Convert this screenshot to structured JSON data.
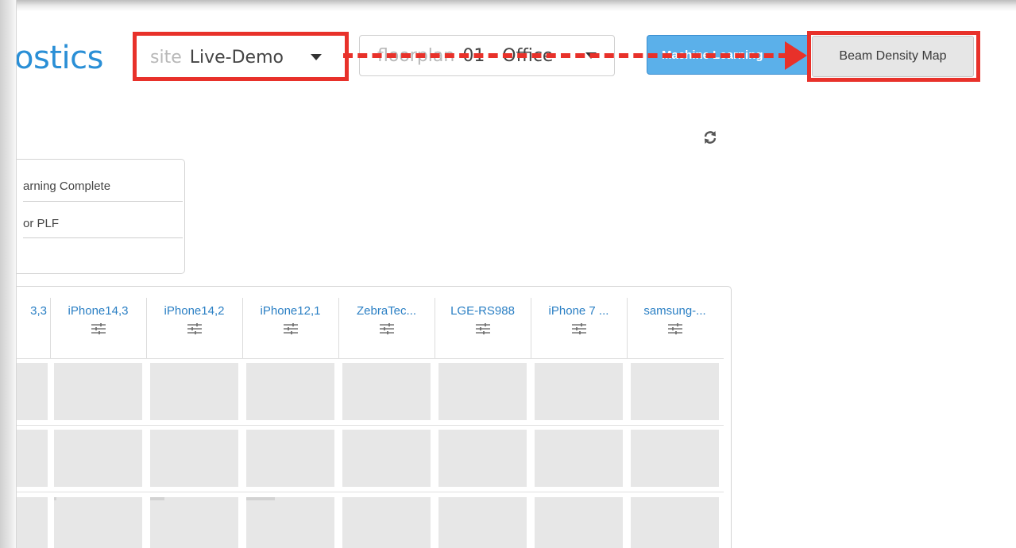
{
  "header": {
    "title_fragment": "ostics",
    "site_select": {
      "prefix": "site",
      "value": "Live-Demo"
    },
    "floorplan_select": {
      "prefix": "floorplan",
      "value": "01 - Office"
    },
    "machine_learning_button": "Machine Learning",
    "beam_density_button": "Beam Density Map"
  },
  "status_panel": {
    "rows": [
      "arning Complete",
      "or PLF"
    ]
  },
  "devices": {
    "columns": [
      "3,3",
      "iPhone14,3",
      "iPhone14,2",
      "iPhone12,1",
      "ZebraTec...",
      "LGE-RS988",
      "iPhone 7 ...",
      "samsung-..."
    ]
  },
  "colors": {
    "accent": "#2a8fd6",
    "highlight": "#e8312a",
    "primary_button": "#5bb0ea",
    "cell_placeholder": "#e7e7e7"
  },
  "icons": {
    "refresh": "refresh-icon",
    "column_settings": "sliders-icon",
    "dropdown": "caret-down-icon"
  }
}
